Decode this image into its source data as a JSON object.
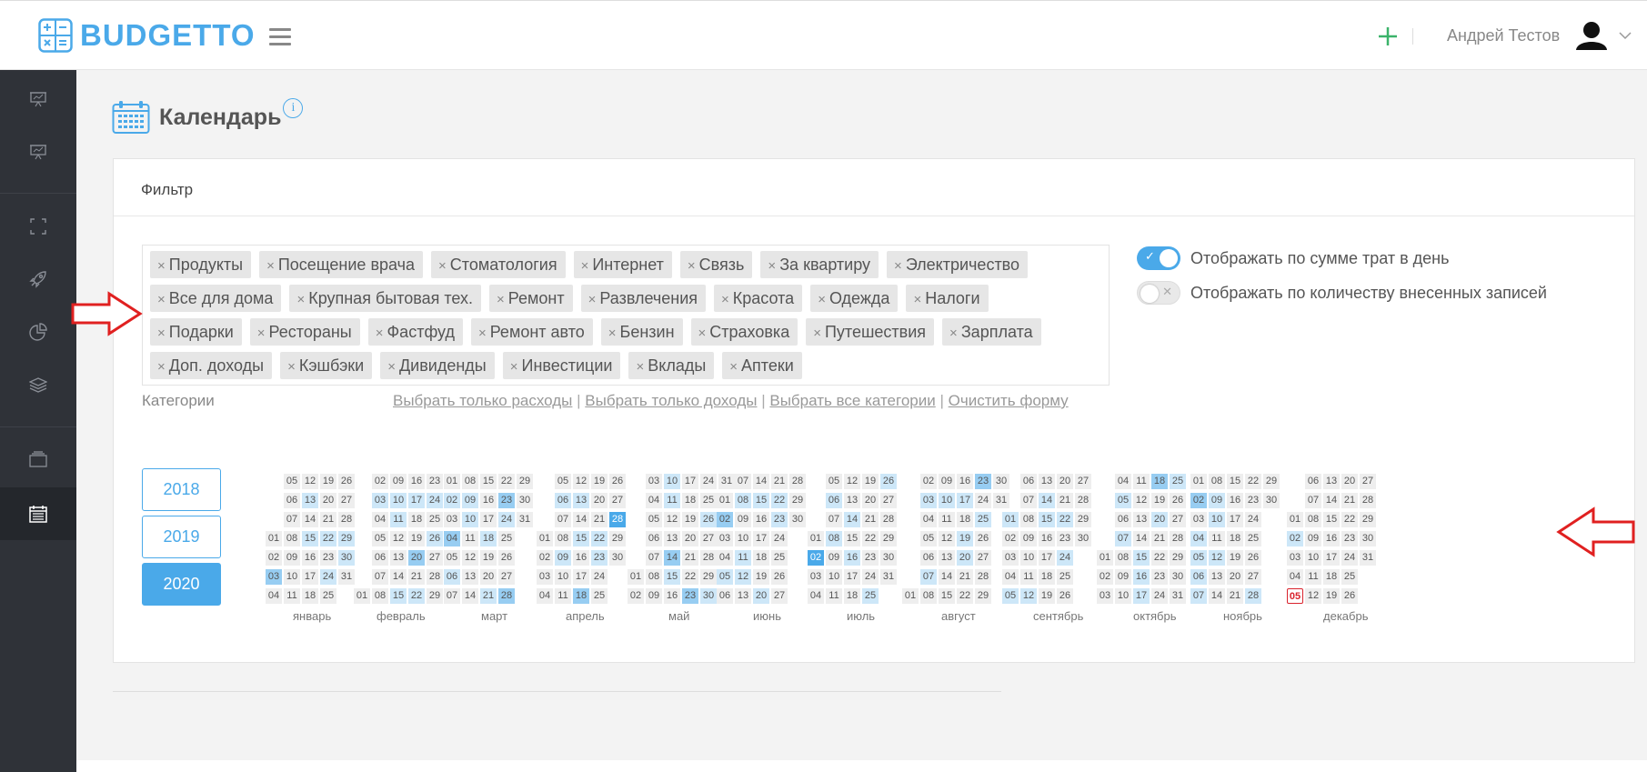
{
  "app": {
    "brand": "BUDGETTO"
  },
  "header": {
    "add_icon": "plus-icon",
    "user_name": "Андрей Тестов"
  },
  "sidebar": {
    "items": [
      {
        "icon": "presentation-icon"
      },
      {
        "icon": "presentation-icon"
      },
      {
        "icon": "fullscreen-icon"
      },
      {
        "icon": "rocket-icon"
      },
      {
        "icon": "pie-chart-icon"
      },
      {
        "icon": "layers-icon"
      },
      {
        "icon": "wallet-icon"
      },
      {
        "icon": "calendar-icon"
      }
    ]
  },
  "page": {
    "title": "Календарь",
    "info": "i"
  },
  "filter": {
    "title": "Фильтр",
    "remove_symbol": "×",
    "tag_rows": [
      [
        "Продукты",
        "Посещение врача",
        "Стоматология",
        "Интернет",
        "Связь",
        "За квартиру",
        "Электричество"
      ],
      [
        "Все для дома",
        "Крупная бытовая тех.",
        "Ремонт",
        "Развлечения",
        "Красота",
        "Одежда",
        "Налоги"
      ],
      [
        "Подарки",
        "Рестораны",
        "Фастфуд",
        "Ремонт авто",
        "Бензин",
        "Страховка",
        "Путешествия",
        "Зарплата"
      ],
      [
        "Доп. доходы",
        "Кэшбэки",
        "Дивиденды",
        "Инвестиции",
        "Вклады",
        "Аптеки"
      ]
    ],
    "categories_label": "Категории",
    "links": [
      "Выбрать только расходы",
      "Выбрать только доходы",
      "Выбрать все категории",
      "Очистить форму"
    ],
    "toggle_sum": {
      "label": "Отображать по сумме трат в день",
      "on": true
    },
    "toggle_count": {
      "label": "Отображать по количеству внесенных записей",
      "on": false
    }
  },
  "years": [
    "2018",
    "2019",
    "2020"
  ],
  "selected_year": "2020",
  "calendar": {
    "today": {
      "month": 11,
      "day": "05"
    },
    "months": [
      {
        "name": "январь",
        "offset": 3,
        "days": 31,
        "levels": {
          "13": 1,
          "15": 1,
          "22": 1,
          "29": 1,
          "30": 1,
          "03": 2,
          "24": 1
        }
      },
      {
        "name": "февраль",
        "offset": 6,
        "days": 29,
        "levels": {
          "03": 1,
          "10": 1,
          "17": 1,
          "24": 1,
          "11": 1,
          "26": 1,
          "20": 2,
          "15": 1,
          "22": 1
        }
      },
      {
        "name": "март",
        "offset": 0,
        "days": 31,
        "levels": {
          "02": 1,
          "09": 1,
          "23": 2,
          "04": 2,
          "06": 1,
          "21": 1,
          "28": 2,
          "10": 1,
          "24": 1,
          "18": 1
        }
      },
      {
        "name": "апрель",
        "offset": 3,
        "days": 30,
        "levels": {
          "06": 1,
          "13": 1,
          "28": 3,
          "15": 1,
          "22": 1,
          "23": 1,
          "18": 2,
          "09": 1
        }
      },
      {
        "name": "май",
        "offset": 5,
        "days": 31,
        "levels": {
          "11": 1,
          "14": 2,
          "15": 1,
          "23": 2,
          "10": 1,
          "26": 1,
          "30": 1
        }
      },
      {
        "name": "июнь",
        "offset": 1,
        "days": 30,
        "levels": {
          "02": 2,
          "08": 1,
          "15": 1,
          "22": 1,
          "23": 1,
          "05": 1,
          "12": 1,
          "11": 1,
          "20": 1
        }
      },
      {
        "name": "июль",
        "offset": 3,
        "days": 31,
        "levels": {
          "02": 3,
          "08": 1,
          "16": 1,
          "06": 1,
          "14": 1,
          "25": 1,
          "26": 1
        }
      },
      {
        "name": "август",
        "offset": 6,
        "days": 31,
        "levels": {
          "03": 1,
          "17": 1,
          "10": 1,
          "25": 1,
          "19": 1,
          "20": 1,
          "23": 2,
          "07": 1
        }
      },
      {
        "name": "сентябрь",
        "offset": 2,
        "days": 30,
        "levels": {
          "14": 1,
          "15": 1,
          "22": 1,
          "24": 1,
          "05": 1,
          "12": 1,
          "01": 1
        }
      },
      {
        "name": "октябрь",
        "offset": 4,
        "days": 31,
        "levels": {
          "05": 1,
          "07": 1,
          "16": 1,
          "15": 1,
          "17": 1,
          "18": 2,
          "20": 1,
          "25": 1
        }
      },
      {
        "name": "ноябрь",
        "offset": 0,
        "days": 30,
        "levels": {
          "02": 2,
          "09": 1,
          "10": 1,
          "12": 1,
          "28": 1,
          "07": 1,
          "04": 1,
          "06": 1,
          "05": 1
        }
      },
      {
        "name": "декабрь",
        "offset": 2,
        "days": 31,
        "levels": {
          "02": 1
        }
      }
    ]
  },
  "colors": {
    "accent": "#4aa9e9",
    "annotation": "#e02020",
    "sidebar": "#2f3238"
  }
}
